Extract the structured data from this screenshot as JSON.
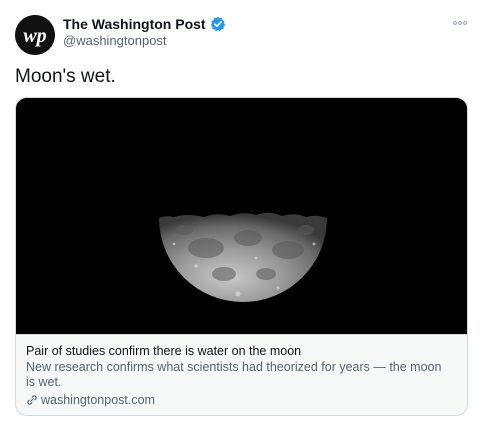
{
  "author": {
    "display_name": "The Washington Post",
    "handle": "@washingtonpost",
    "verified": true,
    "avatar_icon": "wp-logo-icon",
    "avatar_text": "wp"
  },
  "tweet": {
    "text": "Moon's wet."
  },
  "card": {
    "image_icon": "half-moon-photo",
    "title": "Pair of studies confirm there is water on the moon",
    "description": "New research confirms what scientists had theorized for years — the moon is wet.",
    "domain": "washingtonpost.com",
    "domain_icon": "link-icon"
  },
  "colors": {
    "verified_blue": "#1d9bf0",
    "secondary_text": "#536471",
    "border": "#cfd9de",
    "card_footer_bg": "#f7f9f9"
  }
}
